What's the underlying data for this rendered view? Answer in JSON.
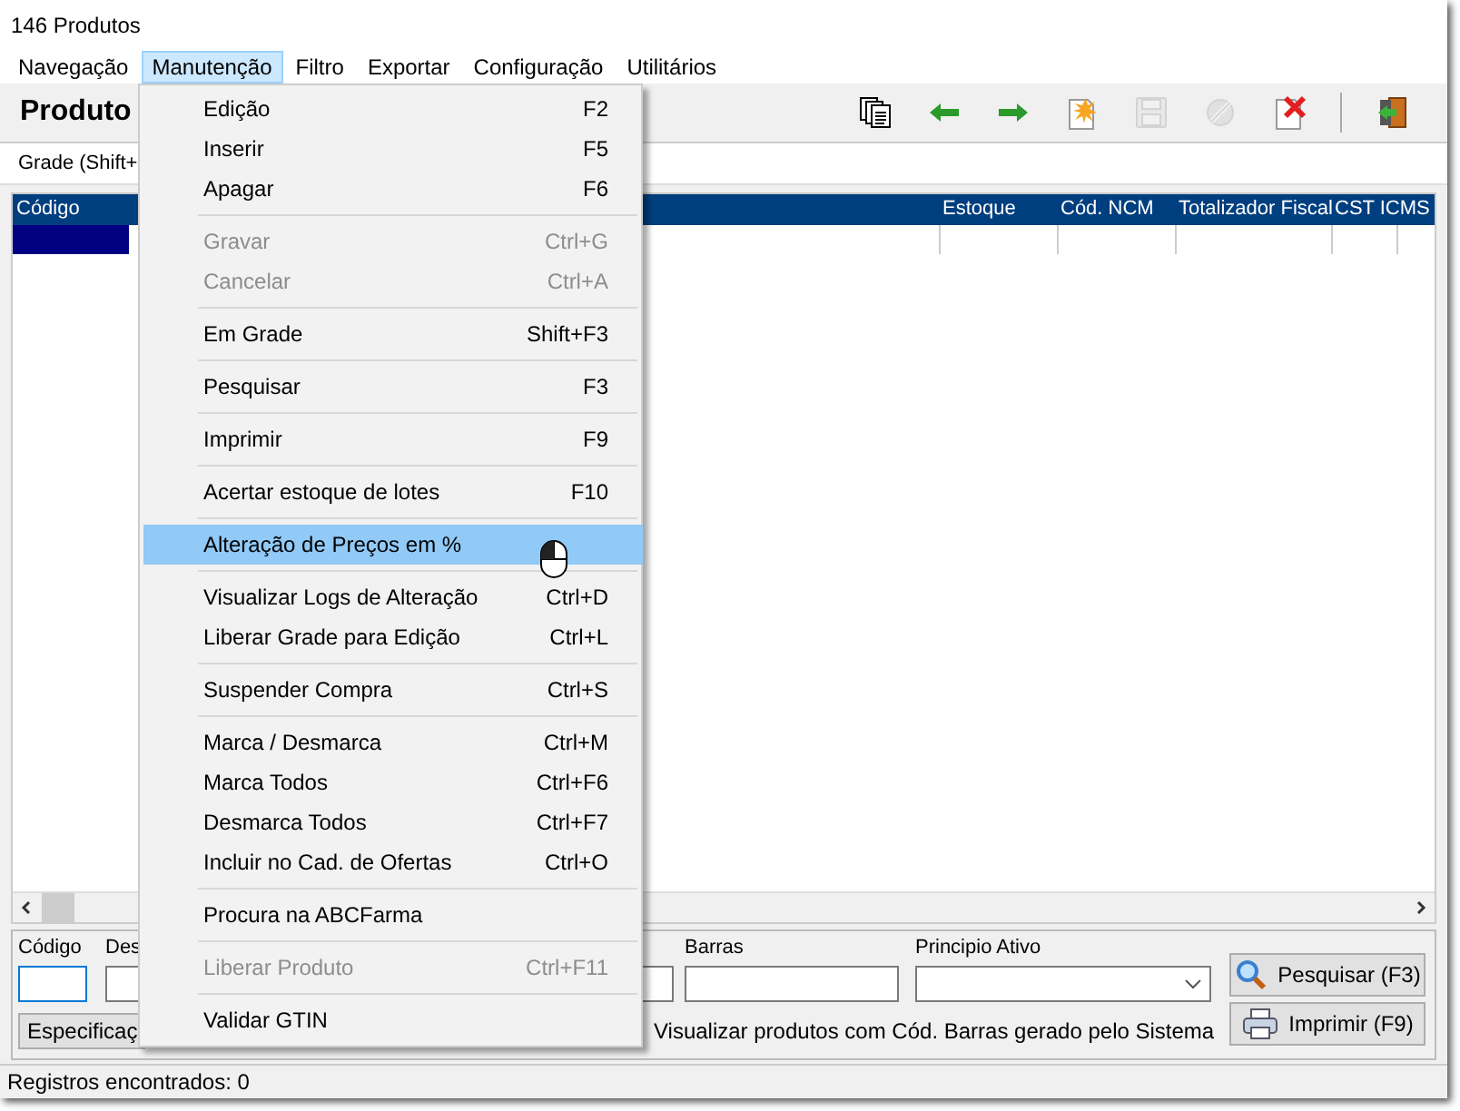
{
  "window": {
    "title": "146 Produtos"
  },
  "menubar": [
    {
      "label": "Navegação",
      "selected": false
    },
    {
      "label": "Manutenção",
      "selected": true
    },
    {
      "label": "Filtro",
      "selected": false
    },
    {
      "label": "Exportar",
      "selected": false
    },
    {
      "label": "Configuração",
      "selected": false
    },
    {
      "label": "Utilitários",
      "selected": false
    }
  ],
  "toolbar": {
    "title": "Produto",
    "buttons": [
      {
        "kind": "copy",
        "disabled": false
      },
      {
        "kind": "back",
        "disabled": false
      },
      {
        "kind": "forward",
        "disabled": false
      },
      {
        "kind": "new",
        "disabled": false
      },
      {
        "kind": "save",
        "disabled": true
      },
      {
        "kind": "cancel",
        "disabled": true
      },
      {
        "kind": "delete",
        "disabled": false
      },
      {
        "kind": "separator"
      },
      {
        "kind": "exit",
        "disabled": false
      }
    ]
  },
  "tab": {
    "label": "Grade (Shift+"
  },
  "grid": {
    "columns": [
      {
        "label": "Código"
      },
      {
        "label": "Estoque"
      },
      {
        "label": "Cód. NCM"
      },
      {
        "label": "Totalizador Fiscal"
      },
      {
        "label": "CST ICMS"
      }
    ]
  },
  "menu": [
    {
      "kind": "item",
      "label": "Edição",
      "shortcut": "F2",
      "disabled": false,
      "selected": false
    },
    {
      "kind": "item",
      "label": "Inserir",
      "shortcut": "F5",
      "disabled": false,
      "selected": false
    },
    {
      "kind": "item",
      "label": "Apagar",
      "shortcut": "F6",
      "disabled": false,
      "selected": false
    },
    {
      "kind": "separator"
    },
    {
      "kind": "item",
      "label": "Gravar",
      "shortcut": "Ctrl+G",
      "disabled": true,
      "selected": false
    },
    {
      "kind": "item",
      "label": "Cancelar",
      "shortcut": "Ctrl+A",
      "disabled": true,
      "selected": false
    },
    {
      "kind": "separator"
    },
    {
      "kind": "item",
      "label": "Em Grade",
      "shortcut": "Shift+F3",
      "disabled": false,
      "selected": false
    },
    {
      "kind": "separator"
    },
    {
      "kind": "item",
      "label": "Pesquisar",
      "shortcut": "F3",
      "disabled": false,
      "selected": false
    },
    {
      "kind": "separator"
    },
    {
      "kind": "item",
      "label": "Imprimir",
      "shortcut": "F9",
      "disabled": false,
      "selected": false
    },
    {
      "kind": "separator"
    },
    {
      "kind": "item",
      "label": "Acertar estoque de lotes",
      "shortcut": "F10",
      "disabled": false,
      "selected": false
    },
    {
      "kind": "separator"
    },
    {
      "kind": "item",
      "label": "Alteração de Preços em %",
      "disabled": false,
      "selected": true
    },
    {
      "kind": "separator"
    },
    {
      "kind": "item",
      "label": "Visualizar Logs de Alteração",
      "shortcut": "Ctrl+D",
      "disabled": false,
      "selected": false
    },
    {
      "kind": "item",
      "label": "Liberar Grade para Edição",
      "shortcut": "Ctrl+L",
      "disabled": false,
      "selected": false
    },
    {
      "kind": "separator"
    },
    {
      "kind": "item",
      "label": "Suspender Compra",
      "shortcut": "Ctrl+S",
      "disabled": false,
      "selected": false
    },
    {
      "kind": "separator"
    },
    {
      "kind": "item",
      "label": "Marca / Desmarca",
      "shortcut": "Ctrl+M",
      "disabled": false,
      "selected": false
    },
    {
      "kind": "item",
      "label": "Marca Todos",
      "shortcut": "Ctrl+F6",
      "disabled": false,
      "selected": false
    },
    {
      "kind": "item",
      "label": "Desmarca Todos",
      "shortcut": "Ctrl+F7",
      "disabled": false,
      "selected": false
    },
    {
      "kind": "item",
      "label": "Incluir no Cad. de Ofertas",
      "shortcut": "Ctrl+O",
      "disabled": false,
      "selected": false
    },
    {
      "kind": "separator"
    },
    {
      "kind": "item",
      "label": "Procura na ABCFarma",
      "disabled": false,
      "selected": false
    },
    {
      "kind": "separator"
    },
    {
      "kind": "item",
      "label": "Liberar Produto",
      "shortcut": "Ctrl+F11",
      "disabled": true,
      "selected": false
    },
    {
      "kind": "separator"
    },
    {
      "kind": "item",
      "label": "Validar GTIN",
      "disabled": false,
      "selected": false
    }
  ],
  "filters": {
    "codigo_label": "Código",
    "descricao_label": "Des",
    "barras_label": "Barras",
    "principio_label": "Principio Ativo",
    "tab_button": "Especificaç",
    "checkbox_label": "Visualizar produtos com Cód. Barras gerado pelo Sistema"
  },
  "buttons": [
    {
      "kind": "search",
      "label": "Pesquisar (F3)"
    },
    {
      "kind": "print",
      "label": "Imprimir (F9)"
    }
  ],
  "status_bar": "Registros encontrados: 0"
}
